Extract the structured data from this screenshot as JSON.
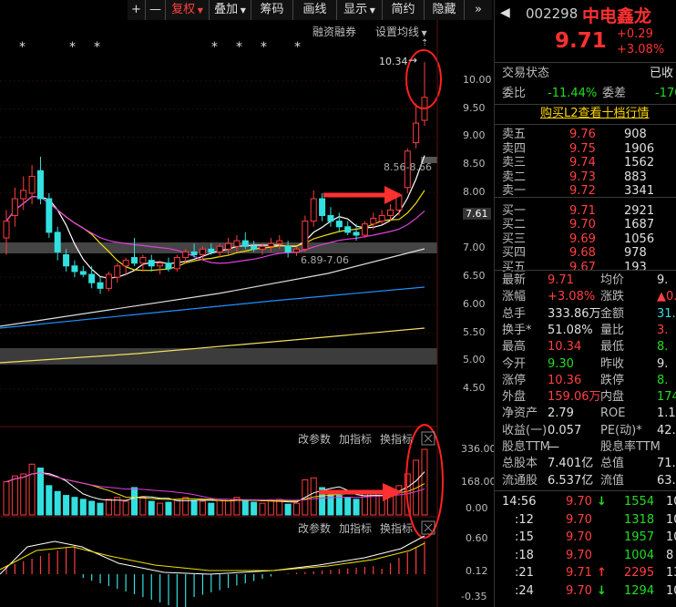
{
  "toolbar": {
    "items": [
      "+",
      "—",
      "复权",
      "叠加",
      "筹码",
      "画线",
      "显示",
      "简约",
      "隐藏"
    ],
    "nav_icon": "double-chevron-right"
  },
  "chart_header": {
    "stars": [
      "*",
      "*",
      "*",
      "*",
      "*",
      "*",
      "*"
    ],
    "margin_label": "融资融券",
    "ma_label": "设置均线"
  },
  "annotations": {
    "high_label": "10.34",
    "range_upper": "8.56-8.66",
    "range_lower": "6.89-7.06"
  },
  "price_axis": {
    "ticks": [
      "10.00",
      "9.50",
      "9.00",
      "8.50",
      "8.00",
      "7.61",
      "7.00",
      "6.50",
      "6.00",
      "5.50",
      "5.00",
      "4.50"
    ],
    "current": "7.61"
  },
  "indicator_panel1": {
    "buttons": [
      "改参数",
      "加指标",
      "换指标"
    ],
    "ticks": [
      "336.00",
      "168.00",
      "0.00"
    ]
  },
  "indicator_panel2": {
    "buttons": [
      "改参数",
      "加指标",
      "换指标"
    ],
    "ticks": [
      "0.60",
      "0.12",
      "-0.35"
    ]
  },
  "chart_data": {
    "type": "candlestick",
    "ylim": [
      4.3,
      10.6
    ],
    "candles": [
      {
        "o": 7.2,
        "h": 7.7,
        "l": 6.9,
        "c": 7.5
      },
      {
        "o": 7.6,
        "h": 8.1,
        "l": 7.4,
        "c": 7.9
      },
      {
        "o": 7.9,
        "h": 8.3,
        "l": 7.7,
        "c": 8.05
      },
      {
        "o": 8.0,
        "h": 8.5,
        "l": 7.8,
        "c": 8.3
      },
      {
        "o": 8.4,
        "h": 8.65,
        "l": 7.8,
        "c": 7.9
      },
      {
        "o": 7.9,
        "h": 8.0,
        "l": 7.2,
        "c": 7.3
      },
      {
        "o": 7.3,
        "h": 7.4,
        "l": 6.8,
        "c": 6.95
      },
      {
        "o": 6.9,
        "h": 7.0,
        "l": 6.6,
        "c": 6.7
      },
      {
        "o": 6.7,
        "h": 6.8,
        "l": 6.5,
        "c": 6.6
      },
      {
        "o": 6.6,
        "h": 6.7,
        "l": 6.5,
        "c": 6.55
      },
      {
        "o": 6.55,
        "h": 6.7,
        "l": 6.3,
        "c": 6.4
      },
      {
        "o": 6.4,
        "h": 6.5,
        "l": 6.2,
        "c": 6.3
      },
      {
        "o": 6.3,
        "h": 6.6,
        "l": 6.25,
        "c": 6.55
      },
      {
        "o": 6.5,
        "h": 6.75,
        "l": 6.4,
        "c": 6.7
      },
      {
        "o": 6.7,
        "h": 6.85,
        "l": 6.55,
        "c": 6.8
      },
      {
        "o": 6.85,
        "h": 7.2,
        "l": 6.7,
        "c": 6.75
      },
      {
        "o": 6.75,
        "h": 6.9,
        "l": 6.6,
        "c": 6.85
      },
      {
        "o": 6.8,
        "h": 6.9,
        "l": 6.6,
        "c": 6.7
      },
      {
        "o": 6.7,
        "h": 6.8,
        "l": 6.55,
        "c": 6.75
      },
      {
        "o": 6.75,
        "h": 6.85,
        "l": 6.6,
        "c": 6.65
      },
      {
        "o": 6.65,
        "h": 6.9,
        "l": 6.6,
        "c": 6.85
      },
      {
        "o": 6.85,
        "h": 7.0,
        "l": 6.75,
        "c": 6.95
      },
      {
        "o": 6.95,
        "h": 7.1,
        "l": 6.85,
        "c": 6.9
      },
      {
        "o": 6.9,
        "h": 7.05,
        "l": 6.8,
        "c": 7.0
      },
      {
        "o": 7.0,
        "h": 7.1,
        "l": 6.9,
        "c": 6.95
      },
      {
        "o": 6.95,
        "h": 7.1,
        "l": 6.85,
        "c": 7.05
      },
      {
        "o": 7.0,
        "h": 7.2,
        "l": 6.9,
        "c": 7.1
      },
      {
        "o": 7.05,
        "h": 7.25,
        "l": 6.95,
        "c": 7.15
      },
      {
        "o": 7.15,
        "h": 7.3,
        "l": 7.0,
        "c": 7.05
      },
      {
        "o": 7.05,
        "h": 7.15,
        "l": 6.95,
        "c": 7.0
      },
      {
        "o": 7.0,
        "h": 7.1,
        "l": 6.9,
        "c": 7.05
      },
      {
        "o": 7.05,
        "h": 7.2,
        "l": 6.95,
        "c": 7.1
      },
      {
        "o": 7.1,
        "h": 7.25,
        "l": 7.0,
        "c": 7.15
      },
      {
        "o": 7.05,
        "h": 7.15,
        "l": 6.85,
        "c": 6.95
      },
      {
        "o": 6.95,
        "h": 7.05,
        "l": 6.88,
        "c": 7.0
      },
      {
        "o": 7.0,
        "h": 7.6,
        "l": 6.95,
        "c": 7.5
      },
      {
        "o": 7.5,
        "h": 8.05,
        "l": 7.4,
        "c": 7.9
      },
      {
        "o": 7.9,
        "h": 8.0,
        "l": 7.5,
        "c": 7.6
      },
      {
        "o": 7.6,
        "h": 7.75,
        "l": 7.4,
        "c": 7.5
      },
      {
        "o": 7.5,
        "h": 7.65,
        "l": 7.3,
        "c": 7.4
      },
      {
        "o": 7.4,
        "h": 7.5,
        "l": 7.25,
        "c": 7.3
      },
      {
        "o": 7.3,
        "h": 7.45,
        "l": 7.15,
        "c": 7.25
      },
      {
        "o": 7.25,
        "h": 7.5,
        "l": 7.2,
        "c": 7.45
      },
      {
        "o": 7.45,
        "h": 7.65,
        "l": 7.35,
        "c": 7.55
      },
      {
        "o": 7.5,
        "h": 7.7,
        "l": 7.45,
        "c": 7.6
      },
      {
        "o": 7.6,
        "h": 7.8,
        "l": 7.5,
        "c": 7.7
      },
      {
        "o": 7.7,
        "h": 8.0,
        "l": 7.6,
        "c": 7.95
      },
      {
        "o": 8.1,
        "h": 8.8,
        "l": 8.0,
        "c": 8.75
      },
      {
        "o": 8.9,
        "h": 9.6,
        "l": 8.8,
        "c": 9.25
      },
      {
        "o": 9.3,
        "h": 10.34,
        "l": 9.2,
        "c": 9.71
      }
    ],
    "vol": [
      170,
      200,
      210,
      260,
      240,
      150,
      120,
      100,
      90,
      80,
      70,
      60,
      80,
      90,
      70,
      140,
      90,
      70,
      60,
      65,
      80,
      90,
      75,
      70,
      60,
      75,
      80,
      90,
      70,
      65,
      60,
      75,
      80,
      55,
      60,
      180,
      190,
      140,
      110,
      100,
      90,
      80,
      110,
      120,
      100,
      130,
      150,
      210,
      280,
      336
    ]
  }
}
